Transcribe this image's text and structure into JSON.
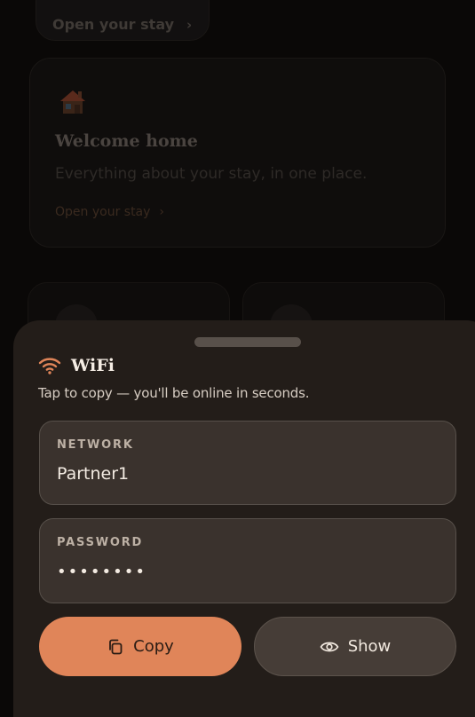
{
  "background": {
    "top_link": {
      "label": "Open your stay",
      "icon": "chevron-right-icon"
    },
    "welcome_card": {
      "icon": "house-icon",
      "title": "Welcome home",
      "subtitle": "Everything about your stay, in one place.",
      "link_label": "Open your stay",
      "link_icon": "chevron-right-icon"
    }
  },
  "sheet": {
    "icon": "wifi-icon",
    "title": "WiFi",
    "subtitle": "Tap to copy — you'll be online in seconds.",
    "network": {
      "label": "NETWORK",
      "value": "Partner1"
    },
    "password": {
      "label": "PASSWORD",
      "value": "••••••••"
    },
    "copy_button": {
      "label": "Copy",
      "icon": "copy-icon"
    },
    "show_button": {
      "label": "Show",
      "icon": "eye-icon"
    }
  },
  "colors": {
    "accent": "#e08559",
    "sheet_bg": "#231d19",
    "field_bg": "#3a322d",
    "page_bg": "#0a0807"
  }
}
